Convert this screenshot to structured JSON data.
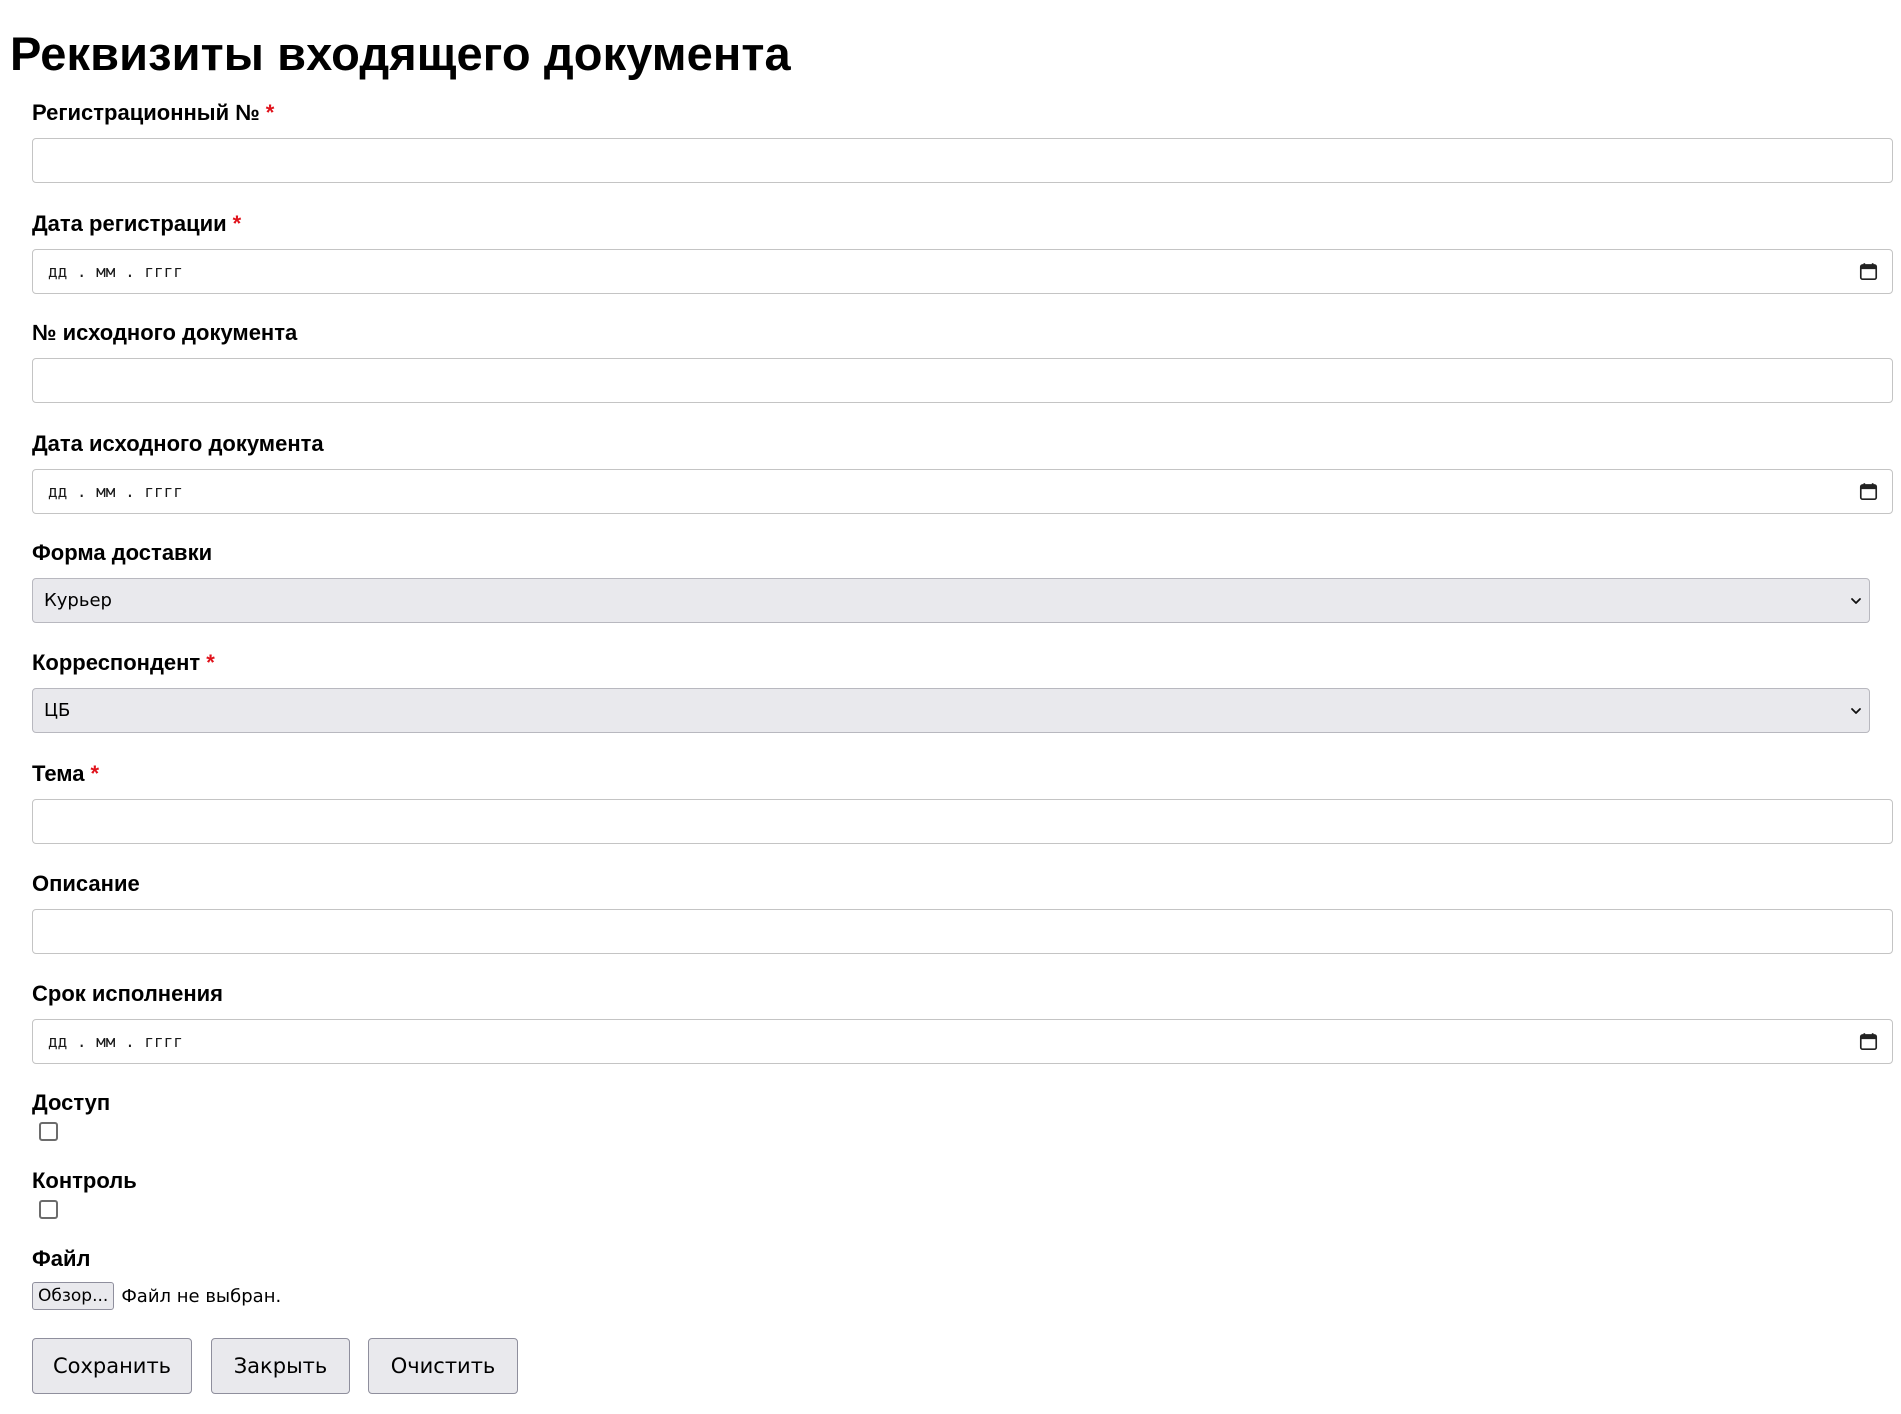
{
  "page": {
    "title": "Реквизиты входящего документа"
  },
  "form": {
    "required_marker": "*",
    "registration_number": {
      "label": "Регистрационный №",
      "required": true,
      "value": ""
    },
    "registration_date": {
      "label": "Дата регистрации",
      "required": true,
      "placeholder": "дд . мм . гггг",
      "icon": "calendar-icon"
    },
    "source_document_number": {
      "label": "№ исходного документа",
      "required": false,
      "value": ""
    },
    "source_document_date": {
      "label": "Дата исходного документа",
      "required": false,
      "placeholder": "дд . мм . гггг",
      "icon": "calendar-icon"
    },
    "delivery_form": {
      "label": "Форма доставки",
      "required": false,
      "selected": "Курьер",
      "icon": "chevron-down-icon"
    },
    "correspondent": {
      "label": "Корреспондент",
      "required": true,
      "selected": "ЦБ",
      "icon": "chevron-down-icon"
    },
    "subject": {
      "label": "Тема",
      "required": true,
      "value": ""
    },
    "description": {
      "label": "Описание",
      "required": false,
      "value": ""
    },
    "due_date": {
      "label": "Срок исполнения",
      "required": false,
      "placeholder": "дд . мм . гггг",
      "icon": "calendar-icon"
    },
    "access": {
      "label": "Доступ",
      "checked": false
    },
    "control": {
      "label": "Контроль",
      "checked": false
    },
    "file": {
      "label": "Файл",
      "browse_label": "Обзор...",
      "status": "Файл не выбран."
    }
  },
  "actions": {
    "save_label": "Сохранить",
    "close_label": "Закрыть",
    "clear_label": "Очистить"
  },
  "colors": {
    "required_marker": "#e0121b",
    "input_border": "#c4c4c4",
    "select_background": "#e9e9ed",
    "button_background": "#e9e9ed"
  }
}
